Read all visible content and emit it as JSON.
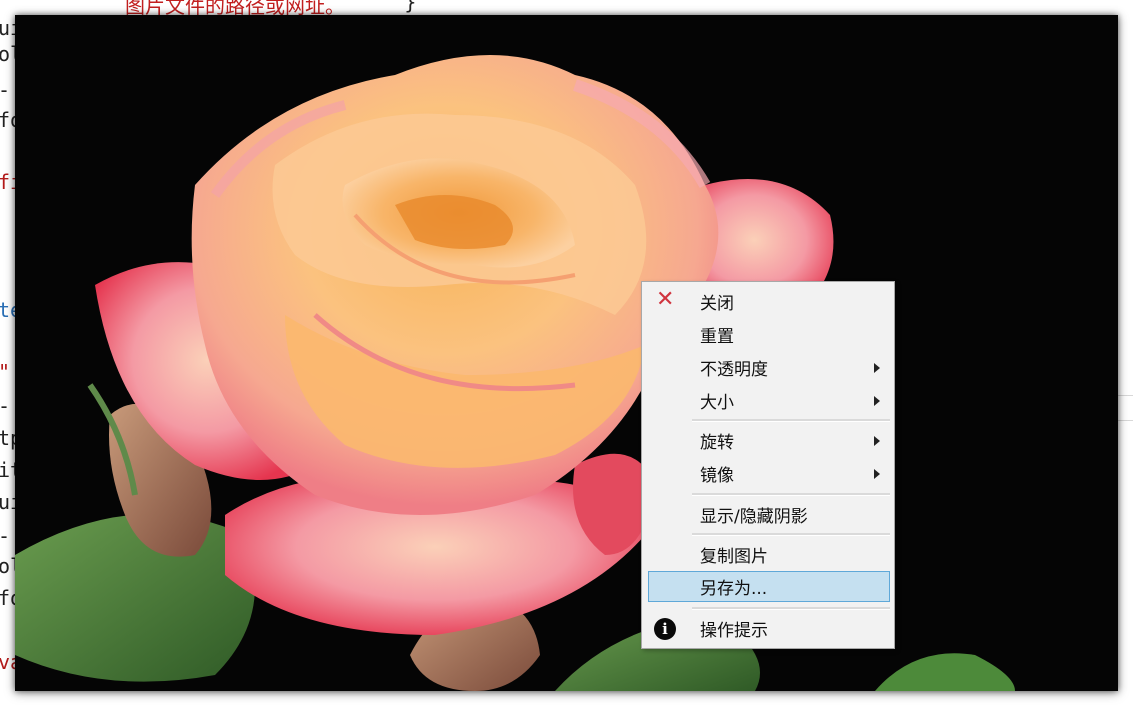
{
  "editor": {
    "top_text": "图片文件的路径或网址。",
    "top_text_right": "}",
    "lines": [
      {
        "text": "ui",
        "color": "dark"
      },
      {
        "text": "ol",
        "color": "dark"
      },
      {
        "text": "-",
        "color": "dark"
      },
      {
        "text": "fo",
        "color": "dark"
      },
      {
        "text": "fi",
        "color": "red"
      },
      {
        "text": "te",
        "color": "blue"
      },
      {
        "text": "\"",
        "color": "red"
      },
      {
        "text": "-",
        "color": "dark"
      },
      {
        "text": "tp",
        "color": "dark"
      },
      {
        "text": "it",
        "color": "dark"
      },
      {
        "text": "ui",
        "color": "dark"
      },
      {
        "text": "-",
        "color": "dark"
      },
      {
        "text": "ol",
        "color": "dark"
      },
      {
        "text": "fo",
        "color": "dark"
      },
      {
        "text": "va",
        "color": "red"
      }
    ]
  },
  "context_menu": {
    "items": [
      {
        "label": "关闭",
        "icon": "close-icon",
        "has_submenu": false
      },
      {
        "label": "重置",
        "has_submenu": false
      },
      {
        "label": "不透明度",
        "has_submenu": true
      },
      {
        "label": "大小",
        "has_submenu": true
      },
      {
        "label": "旋转",
        "has_submenu": true
      },
      {
        "label": "镜像",
        "has_submenu": true
      },
      {
        "label": "显示/隐藏阴影",
        "has_submenu": false
      },
      {
        "label": "复制图片",
        "has_submenu": false
      },
      {
        "label": "另存为...",
        "has_submenu": false,
        "highlighted": true
      },
      {
        "label": "操作提示",
        "icon": "info-icon",
        "has_submenu": false
      }
    ]
  },
  "colors": {
    "menu_bg": "#f2f2f2",
    "highlight_bg": "#c5e0f0",
    "highlight_border": "#5fa8d8",
    "close_icon": "#d0343e",
    "image_bg": "#050505"
  }
}
